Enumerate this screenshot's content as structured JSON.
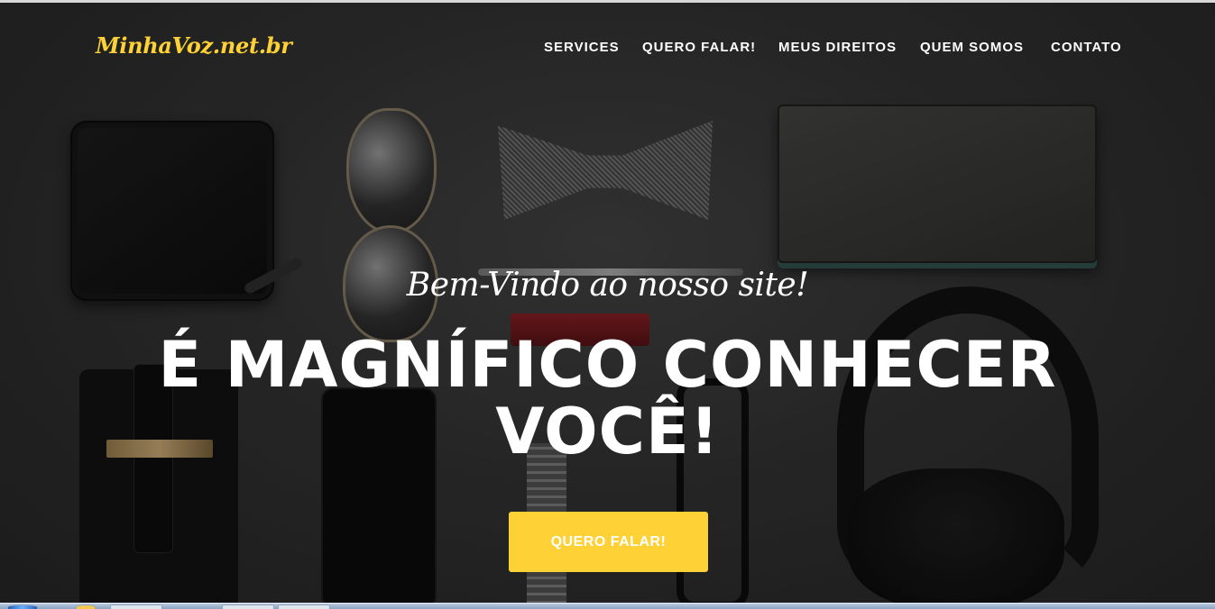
{
  "brand": {
    "logo": "MinhaVoz.net.br",
    "accent_color": "#fed136"
  },
  "nav": {
    "items": [
      {
        "label": "SERVICES"
      },
      {
        "label": "QUERO FALAR!"
      },
      {
        "label": "MEUS DIREITOS"
      },
      {
        "label": "QUEM SOMOS"
      },
      {
        "label": "CONTATO"
      }
    ]
  },
  "intro": {
    "lead_in": "Bem-Vindo ao nosso site!",
    "heading_line1": "É MAGNÍFICO CONHECER",
    "heading_line2": "VOCÊ!",
    "cta_label": "QUERO FALAR!"
  },
  "background": {
    "objects": [
      "wallet",
      "sunglasses",
      "bow-tie",
      "notebook",
      "pen",
      "lipstick",
      "phone-case",
      "smartphone",
      "wristwatch",
      "eyeglasses",
      "headphones"
    ]
  }
}
